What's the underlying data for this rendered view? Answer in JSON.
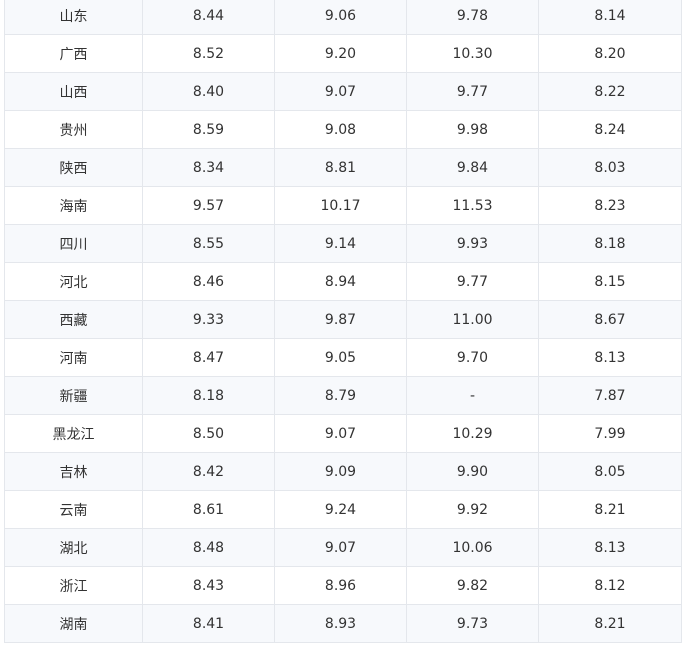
{
  "table": {
    "rows": [
      [
        "山东",
        "8.44",
        "9.06",
        "9.78",
        "8.14"
      ],
      [
        "广西",
        "8.52",
        "9.20",
        "10.30",
        "8.20"
      ],
      [
        "山西",
        "8.40",
        "9.07",
        "9.77",
        "8.22"
      ],
      [
        "贵州",
        "8.59",
        "9.08",
        "9.98",
        "8.24"
      ],
      [
        "陕西",
        "8.34",
        "8.81",
        "9.84",
        "8.03"
      ],
      [
        "海南",
        "9.57",
        "10.17",
        "11.53",
        "8.23"
      ],
      [
        "四川",
        "8.55",
        "9.14",
        "9.93",
        "8.18"
      ],
      [
        "河北",
        "8.46",
        "8.94",
        "9.77",
        "8.15"
      ],
      [
        "西藏",
        "9.33",
        "9.87",
        "11.00",
        "8.67"
      ],
      [
        "河南",
        "8.47",
        "9.05",
        "9.70",
        "8.13"
      ],
      [
        "新疆",
        "8.18",
        "8.79",
        "-",
        "7.87"
      ],
      [
        "黑龙江",
        "8.50",
        "9.07",
        "10.29",
        "7.99"
      ],
      [
        "吉林",
        "8.42",
        "9.09",
        "9.90",
        "8.05"
      ],
      [
        "云南",
        "8.61",
        "9.24",
        "9.92",
        "8.21"
      ],
      [
        "湖北",
        "8.48",
        "9.07",
        "10.06",
        "8.13"
      ],
      [
        "浙江",
        "8.43",
        "8.96",
        "9.82",
        "8.12"
      ],
      [
        "湖南",
        "8.41",
        "8.93",
        "9.73",
        "8.21"
      ]
    ]
  }
}
